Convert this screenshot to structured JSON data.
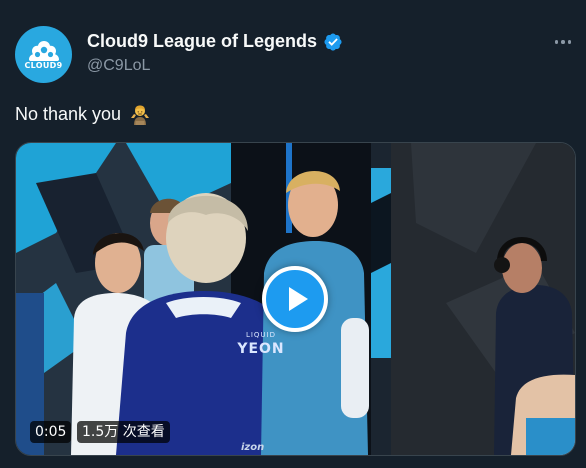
{
  "tweet": {
    "author": {
      "display_name": "Cloud9 League of Legends",
      "handle": "@C9LoL",
      "avatar_logo_text": "CLOUD9",
      "verified": true,
      "avatar_color": "#29a8e0"
    },
    "text": "No thank you",
    "emoji": "person-shrugging-emoji",
    "more_icon": "more-horizontal-icon"
  },
  "video": {
    "duration": "0:05",
    "views": "1.5万 次查看",
    "jersey_name": "YEON",
    "jersey_tag": "LIQUID",
    "sponsor_text": "izon",
    "play_icon": "play-icon"
  },
  "colors": {
    "background": "#15202b",
    "text": "#f7f9f9",
    "secondary": "#8b98a5",
    "accent": "#1d9bf0",
    "border": "#38444d"
  }
}
